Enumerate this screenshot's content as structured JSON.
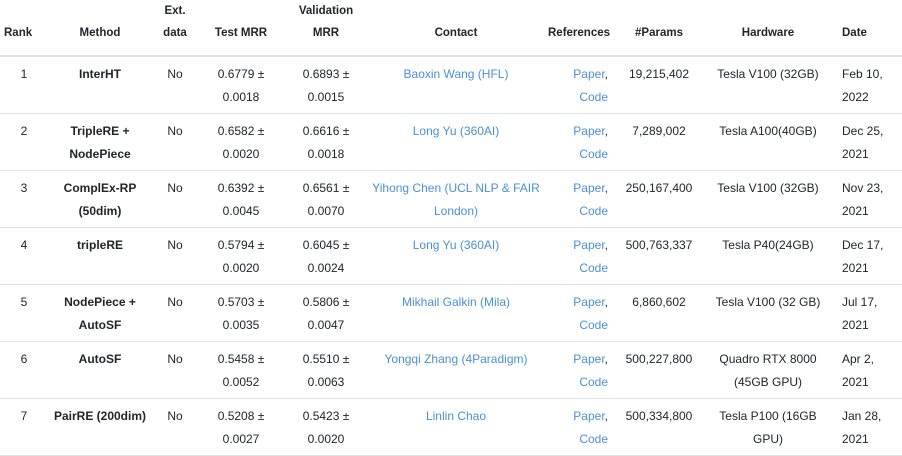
{
  "headers": {
    "rank": "Rank",
    "method": "Method",
    "ext_data_1": "Ext.",
    "ext_data_2": "data",
    "test_mrr": "Test MRR",
    "val_mrr_1": "Validation",
    "val_mrr_2": "MRR",
    "contact": "Contact",
    "references": "References",
    "params": "#Params",
    "hardware": "Hardware",
    "date": "Date"
  },
  "rows": [
    {
      "rank": "1",
      "method_1": "InterHT",
      "method_2": "",
      "ext": "No",
      "test_1": "0.6779 ±",
      "test_2": "0.0018",
      "val_1": "0.6893 ±",
      "val_2": "0.0015",
      "contact_1": "Baoxin Wang (HFL)",
      "contact_2": "",
      "paper": "Paper",
      "code": "Code",
      "params": "19,215,402",
      "hw_1": "Tesla V100 (32GB)",
      "hw_2": "",
      "date_1": "Feb 10,",
      "date_2": "2022"
    },
    {
      "rank": "2",
      "method_1": "TripleRE +",
      "method_2": "NodePiece",
      "ext": "No",
      "test_1": "0.6582 ±",
      "test_2": "0.0020",
      "val_1": "0.6616 ±",
      "val_2": "0.0018",
      "contact_1": "Long Yu (360AI)",
      "contact_2": "",
      "paper": "Paper",
      "code": "Code",
      "params": "7,289,002",
      "hw_1": "Tesla A100(40GB)",
      "hw_2": "",
      "date_1": "Dec 25,",
      "date_2": "2021"
    },
    {
      "rank": "3",
      "method_1": "ComplEx-RP",
      "method_2": "(50dim)",
      "ext": "No",
      "test_1": "0.6392 ±",
      "test_2": "0.0045",
      "val_1": "0.6561 ±",
      "val_2": "0.0070",
      "contact_1": "Yihong Chen (UCL NLP & FAIR",
      "contact_2": "London)",
      "paper": "Paper",
      "code": "Code",
      "params": "250,167,400",
      "hw_1": "Tesla V100 (32GB)",
      "hw_2": "",
      "date_1": "Nov 23,",
      "date_2": "2021"
    },
    {
      "rank": "4",
      "method_1": "tripleRE",
      "method_2": "",
      "ext": "No",
      "test_1": "0.5794 ±",
      "test_2": "0.0020",
      "val_1": "0.6045 ±",
      "val_2": "0.0024",
      "contact_1": "Long Yu (360AI)",
      "contact_2": "",
      "paper": "Paper",
      "code": "Code",
      "params": "500,763,337",
      "hw_1": "Tesla P40(24GB)",
      "hw_2": "",
      "date_1": "Dec 17,",
      "date_2": "2021"
    },
    {
      "rank": "5",
      "method_1": "NodePiece +",
      "method_2": "AutoSF",
      "ext": "No",
      "test_1": "0.5703 ±",
      "test_2": "0.0035",
      "val_1": "0.5806 ±",
      "val_2": "0.0047",
      "contact_1": "Mikhail Galkin (Mila)",
      "contact_2": "",
      "paper": "Paper",
      "code": "Code",
      "params": "6,860,602",
      "hw_1": "Tesla V100 (32 GB)",
      "hw_2": "",
      "date_1": "Jul 17,",
      "date_2": "2021"
    },
    {
      "rank": "6",
      "method_1": "AutoSF",
      "method_2": "",
      "ext": "No",
      "test_1": "0.5458 ±",
      "test_2": "0.0052",
      "val_1": "0.5510 ±",
      "val_2": "0.0063",
      "contact_1": "Yongqi Zhang (4Paradigm)",
      "contact_2": "",
      "paper": "Paper",
      "code": "Code",
      "params": "500,227,800",
      "hw_1": "Quadro RTX 8000",
      "hw_2": "(45GB GPU)",
      "date_1": "Apr 2,",
      "date_2": "2021"
    },
    {
      "rank": "7",
      "method_1": "PairRE (200dim)",
      "method_2": "",
      "ext": "No",
      "test_1": "0.5208 ±",
      "test_2": "0.0027",
      "val_1": "0.5423 ±",
      "val_2": "0.0020",
      "contact_1": "Linlin Chao",
      "contact_2": "",
      "paper": "Paper",
      "code": "Code",
      "params": "500,334,800",
      "hw_1": "Tesla P100 (16GB",
      "hw_2": "GPU)",
      "date_1": "Jan 28,",
      "date_2": "2021"
    }
  ]
}
